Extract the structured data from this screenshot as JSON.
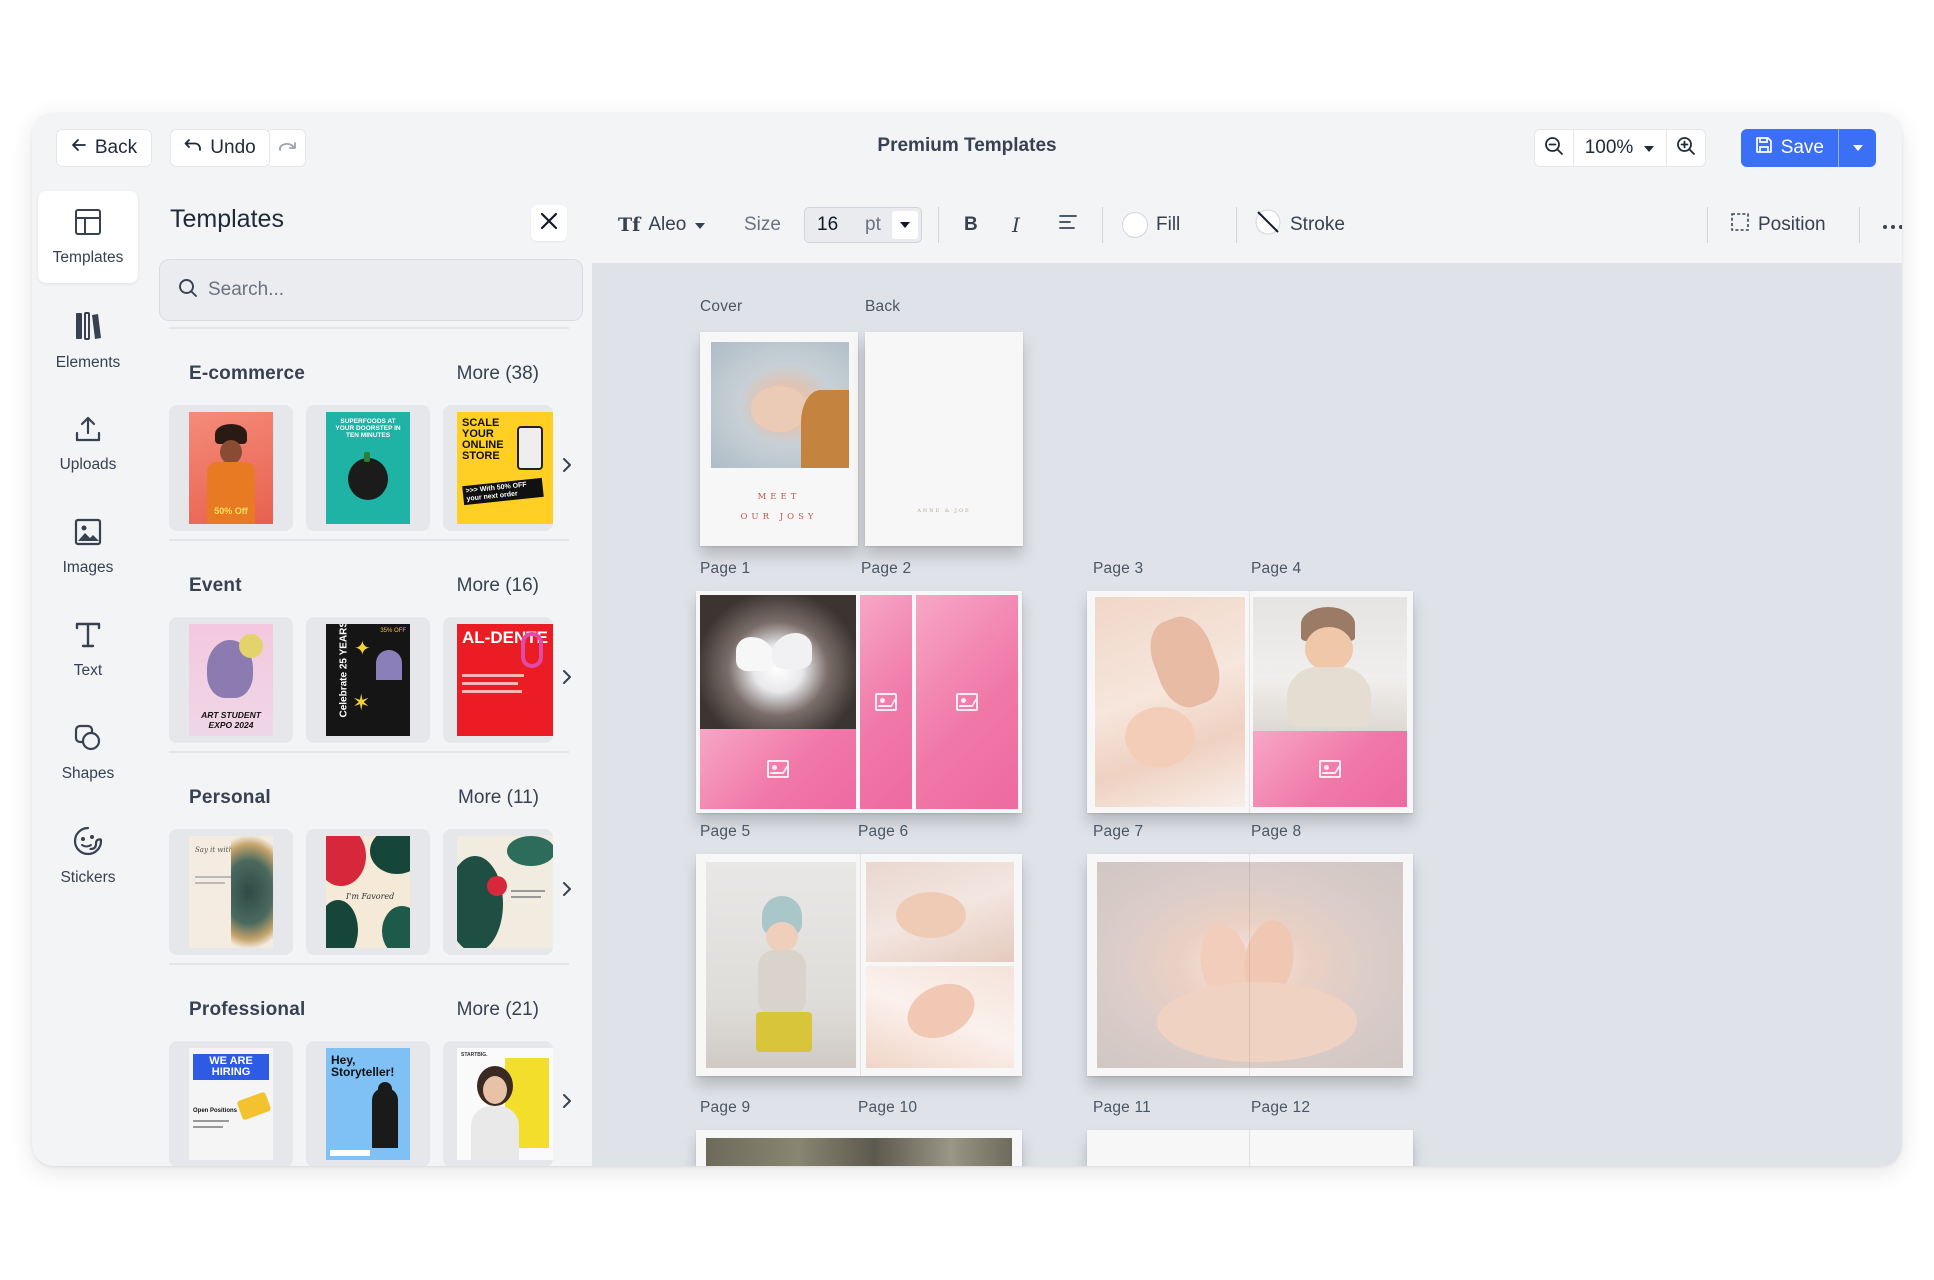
{
  "topbar": {
    "back_label": "Back",
    "undo_label": "Undo",
    "title": "Premium Templates",
    "zoom_value": "100%",
    "save_label": "Save"
  },
  "rail": {
    "items": [
      {
        "label": "Templates",
        "icon": "templates-icon"
      },
      {
        "label": "Elements",
        "icon": "elements-icon"
      },
      {
        "label": "Uploads",
        "icon": "upload-icon"
      },
      {
        "label": "Images",
        "icon": "image-icon"
      },
      {
        "label": "Text",
        "icon": "text-icon"
      },
      {
        "label": "Shapes",
        "icon": "shapes-icon"
      },
      {
        "label": "Stickers",
        "icon": "sticker-icon"
      }
    ]
  },
  "panel": {
    "title": "Templates",
    "search_placeholder": "Search...",
    "sections": [
      {
        "title": "E-commerce",
        "more": "More (38)",
        "thumbs": [
          {
            "text": "50% Off"
          },
          {
            "text": "SUPERFOODS AT YOUR DOORSTEP IN TEN MINUTES"
          },
          {
            "text": "SCALE YOUR ONLINE STORE",
            "sub": ">>> With 50% OFF your next order"
          }
        ]
      },
      {
        "title": "Event",
        "more": "More (16)",
        "thumbs": [
          {
            "text": "ART STUDENT EXPO 2024"
          },
          {
            "text": "Celebrate 25 YEARS",
            "sub": "35% OFF"
          },
          {
            "text": "AL-DENTE"
          }
        ]
      },
      {
        "title": "Personal",
        "more": "More (11)",
        "thumbs": [
          {
            "text": "Say it with me"
          },
          {
            "text": "I'm Favored"
          },
          {
            "text": ""
          }
        ]
      },
      {
        "title": "Professional",
        "more": "More (21)",
        "thumbs": [
          {
            "text": "WE ARE HIRING",
            "sub": "Open Positions"
          },
          {
            "text": "Hey, Storyteller!"
          },
          {
            "text": "STARTBIG."
          }
        ]
      }
    ]
  },
  "format": {
    "font": "Aleo",
    "size_label": "Size",
    "size_value": "16",
    "size_unit": "pt",
    "fill_label": "Fill",
    "stroke_label": "Stroke",
    "position_label": "Position"
  },
  "pages": {
    "cover_label": "Cover",
    "back_label": "Back",
    "cover_text_1": "MEET",
    "cover_text_2": "OUR JOSY",
    "back_text": "ANNE & JOE",
    "labels": [
      "Page 1",
      "Page 2",
      "Page 3",
      "Page 4",
      "Page 5",
      "Page 6",
      "Page 7",
      "Page 8",
      "Page 9",
      "Page 10",
      "Page 11",
      "Page 12"
    ]
  },
  "colors": {
    "accent": "#3b6ff5",
    "pink_placeholder": "#f079a8"
  }
}
